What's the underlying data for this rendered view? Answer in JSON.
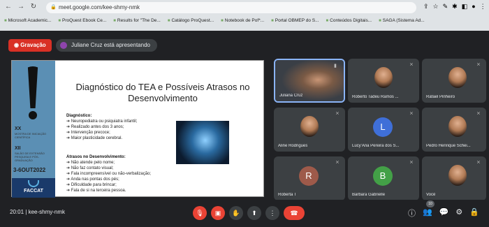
{
  "browser": {
    "url": "meet.google.com/kee-shmy-nmk",
    "bookmarks": [
      "Microsoft Academic...",
      "ProQuest Ebook Ce...",
      "Results for \"The De...",
      "Catálogo ProQuest...",
      "Notebook de Pof*...",
      "Portal OBMEP do S...",
      "Conteúdos Digitais...",
      "SAGA (Sistema Ad..."
    ]
  },
  "meet": {
    "recording_label": "Gravação",
    "presenting_label": "Juliane Cruz está apresentando",
    "time": "20:01",
    "meeting_code": "kee-shmy-nmk",
    "participants_count": "10"
  },
  "slide": {
    "title": "Diagnóstico  do TEA e Possíveis Atrasos no Desenvolvimento",
    "diagnostico_heading": "Diagnóstico:",
    "diagnostico_items": [
      "Neuropediatra ou psiquiatra infantil;",
      "Realizado antes dos 3 anos;",
      "Intervenção precoce;",
      "Maior plasticidade cerebral."
    ],
    "atrasos_heading": "Atrasos no Desenvolvimento:",
    "atrasos_items": [
      "Não atende pelo nome;",
      "Não faz contato visual;",
      "Fala incompreensível ou não-verbalização;",
      "Anda nas pontas dos pés;",
      "Dificuldade para brincar;",
      "Fala de si na terceira pessoa."
    ],
    "branding": {
      "xx": "XX",
      "xx_sub": "MOSTRA DE INICIAÇÃO CIENTÍFICA",
      "xii": "XII",
      "xii_sub": "SALÃO DE EXTENSÃO PESQUISA E PÓS-GRADUAÇÃO",
      "date": "3-6OUT2022",
      "logo": "FACCAT"
    }
  },
  "tiles": [
    {
      "name": "Juliana Cruz"
    },
    {
      "name": "Roberto Tadeu Ramos ..."
    },
    {
      "name": "Rafael Pinheiro"
    },
    {
      "name": "Aline Rodrigues"
    },
    {
      "name": "Lucy'Ana Pereira dos S...",
      "initial": "L",
      "color": "#3f6fd8"
    },
    {
      "name": "Pedro Henrique Schei..."
    },
    {
      "name": "Roberta T",
      "initial": "R",
      "color": "#9e5a4a"
    },
    {
      "name": "Barbara Gabrielle",
      "initial": "B",
      "color": "#43a047"
    },
    {
      "name": "Você"
    }
  ]
}
